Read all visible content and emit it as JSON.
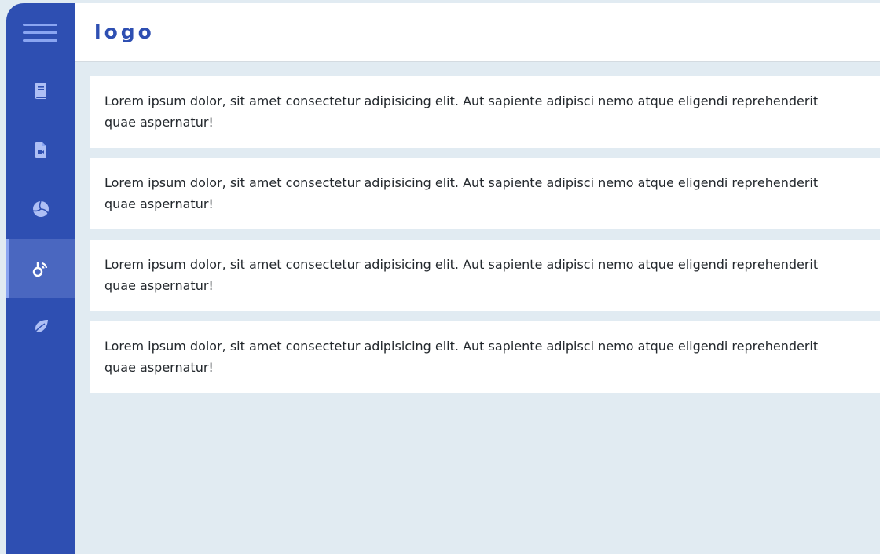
{
  "header": {
    "logo": "logo"
  },
  "sidebar": {
    "accent_color": "#2e4fb2",
    "items": [
      {
        "icon": "book-icon",
        "active": false
      },
      {
        "icon": "file-video-icon",
        "active": false
      },
      {
        "icon": "volleyball-icon",
        "active": false
      },
      {
        "icon": "connection-icon",
        "active": true
      },
      {
        "icon": "leaf-icon",
        "active": false
      }
    ]
  },
  "main": {
    "cards": [
      {
        "line1": "Lorem ipsum dolor, sit amet consectetur adipisicing elit. Aut sapiente adipisci nemo atque eligendi reprehenderit",
        "line2": "quae aspernatur!"
      },
      {
        "line1": "Lorem ipsum dolor, sit amet consectetur adipisicing elit. Aut sapiente adipisci nemo atque eligendi reprehenderit",
        "line2": "quae aspernatur!"
      },
      {
        "line1": "Lorem ipsum dolor, sit amet consectetur adipisicing elit. Aut sapiente adipisci nemo atque eligendi reprehenderit",
        "line2": "quae aspernatur!"
      },
      {
        "line1": "Lorem ipsum dolor, sit amet consectetur adipisicing elit. Aut sapiente adipisci nemo atque eligendi reprehenderit",
        "line2": "quae aspernatur!"
      }
    ]
  }
}
